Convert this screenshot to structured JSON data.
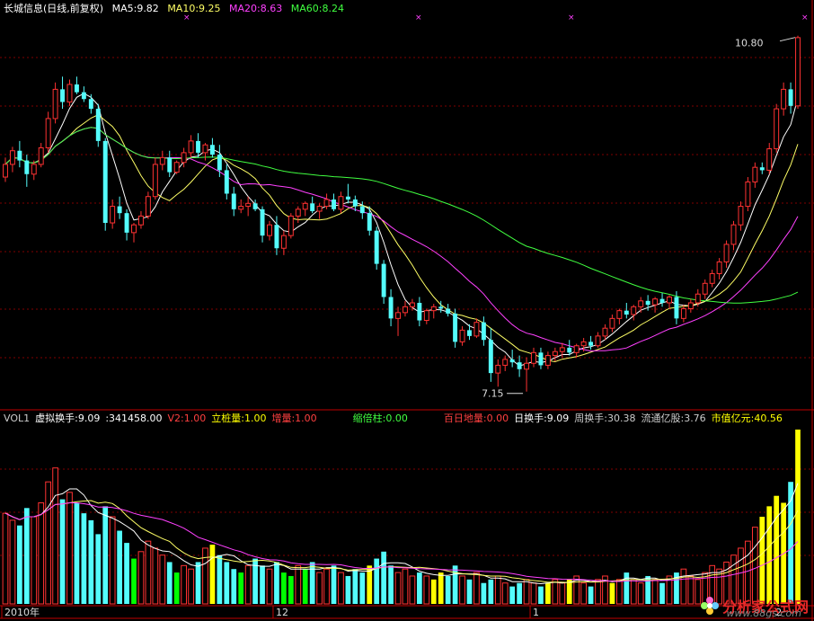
{
  "header": {
    "title": "长城信息(日线,前复权)",
    "ma": [
      {
        "label": "MA5:9.82",
        "color": "#ffffff"
      },
      {
        "label": "MA10:9.25",
        "color": "#ffff66"
      },
      {
        "label": "MA20:8.63",
        "color": "#ff40ff"
      },
      {
        "label": "MA60:8.24",
        "color": "#40ff40"
      }
    ]
  },
  "volume_header": {
    "items": [
      {
        "label": "VOL1",
        "color": "#cccccc"
      },
      {
        "label": "虚拟换手:9.09",
        "color": "#ffffff"
      },
      {
        "label": ":341458.00",
        "color": "#ffffff"
      },
      {
        "label": "V2:1.00",
        "color": "#ff4040"
      },
      {
        "label": "立桩量:1.00",
        "color": "#ffff00"
      },
      {
        "label": "增量:1.00",
        "color": "#ff4040"
      },
      {
        "label": "缩倍柱:0.00",
        "color": "#40ff40"
      },
      {
        "label": "百日地量:0.00",
        "color": "#ff4040"
      },
      {
        "label": "日换手:9.09",
        "color": "#ffffff"
      },
      {
        "label": "周换手:30.38",
        "color": "#cccccc"
      },
      {
        "label": "流通亿股:3.76",
        "color": "#cccccc"
      },
      {
        "label": "市值亿元:40.56",
        "color": "#ffff00"
      }
    ]
  },
  "annotations": {
    "high_label": "10.80",
    "low_label": "7.15"
  },
  "watermark": {
    "text": "分析家公式网",
    "url": "www.88gs.com"
  },
  "colors": {
    "up": "#ff3232",
    "down": "#54fcfc",
    "volume_highlight": "#ffff00",
    "volume_shrink": "#00ff00",
    "grid": "#800000",
    "axis": "#c00000"
  },
  "chart_data": [
    {
      "type": "candlestick",
      "title": "长城信息(日线,前复权)",
      "ylim": [
        7.0,
        11.0
      ],
      "series_names": [
        "MA5",
        "MA10",
        "MA20",
        "MA60"
      ],
      "x_ticks": [
        {
          "index": 0,
          "label": "2010年"
        },
        {
          "index": 38,
          "label": "12"
        },
        {
          "index": 74,
          "label": "1"
        },
        {
          "index": 108,
          "label": "2"
        }
      ],
      "candles": [
        [
          9.35,
          9.55,
          9.3,
          9.48
        ],
        [
          9.48,
          9.66,
          9.4,
          9.62
        ],
        [
          9.62,
          9.72,
          9.45,
          9.52
        ],
        [
          9.52,
          9.58,
          9.25,
          9.38
        ],
        [
          9.38,
          9.52,
          9.32,
          9.48
        ],
        [
          9.48,
          9.7,
          9.45,
          9.65
        ],
        [
          9.65,
          10.02,
          9.6,
          9.95
        ],
        [
          9.95,
          10.32,
          9.9,
          10.25
        ],
        [
          10.25,
          10.38,
          10.05,
          10.12
        ],
        [
          10.12,
          10.35,
          10.08,
          10.3
        ],
        [
          10.3,
          10.38,
          10.2,
          10.22
        ],
        [
          10.22,
          10.28,
          10.12,
          10.15
        ],
        [
          10.15,
          10.2,
          10.0,
          10.05
        ],
        [
          10.05,
          10.1,
          9.66,
          9.72
        ],
        [
          9.72,
          9.75,
          8.8,
          8.88
        ],
        [
          8.88,
          9.12,
          8.82,
          9.05
        ],
        [
          9.05,
          9.15,
          8.92,
          8.98
        ],
        [
          8.98,
          9.02,
          8.7,
          8.78
        ],
        [
          8.78,
          8.88,
          8.68,
          8.86
        ],
        [
          8.86,
          9.0,
          8.82,
          8.95
        ],
        [
          8.95,
          9.2,
          8.92,
          9.15
        ],
        [
          9.15,
          9.55,
          9.12,
          9.48
        ],
        [
          9.48,
          9.62,
          9.42,
          9.55
        ],
        [
          9.55,
          9.62,
          9.35,
          9.4
        ],
        [
          9.4,
          9.52,
          9.38,
          9.5
        ],
        [
          9.5,
          9.65,
          9.45,
          9.6
        ],
        [
          9.6,
          9.78,
          9.55,
          9.72
        ],
        [
          9.72,
          9.8,
          9.55,
          9.6
        ],
        [
          9.6,
          9.7,
          9.52,
          9.68
        ],
        [
          9.68,
          9.75,
          9.55,
          9.58
        ],
        [
          9.58,
          9.68,
          9.35,
          9.42
        ],
        [
          9.42,
          9.48,
          9.12,
          9.18
        ],
        [
          9.18,
          9.25,
          8.95,
          9.02
        ],
        [
          9.02,
          9.12,
          8.98,
          9.05
        ],
        [
          9.05,
          9.15,
          8.95,
          9.08
        ],
        [
          9.08,
          9.12,
          9.0,
          9.02
        ],
        [
          9.02,
          9.05,
          8.68,
          8.75
        ],
        [
          8.75,
          8.9,
          8.7,
          8.86
        ],
        [
          8.86,
          8.95,
          8.55,
          8.62
        ],
        [
          8.62,
          8.8,
          8.55,
          8.75
        ],
        [
          8.75,
          8.98,
          8.72,
          8.95
        ],
        [
          8.95,
          9.05,
          8.88,
          9.02
        ],
        [
          9.02,
          9.1,
          8.95,
          9.08
        ],
        [
          9.08,
          9.15,
          8.98,
          9.0
        ],
        [
          9.0,
          9.08,
          8.92,
          9.05
        ],
        [
          9.05,
          9.18,
          9.02,
          9.12
        ],
        [
          9.12,
          9.18,
          9.0,
          9.02
        ],
        [
          9.02,
          9.2,
          8.98,
          9.15
        ],
        [
          9.15,
          9.28,
          9.08,
          9.12
        ],
        [
          9.12,
          9.16,
          9.0,
          9.05
        ],
        [
          9.05,
          9.1,
          8.92,
          8.98
        ],
        [
          8.98,
          9.05,
          8.75,
          8.8
        ],
        [
          8.8,
          8.84,
          8.4,
          8.46
        ],
        [
          8.46,
          8.5,
          8.05,
          8.12
        ],
        [
          8.12,
          8.2,
          7.82,
          7.9
        ],
        [
          7.9,
          8.02,
          7.72,
          7.96
        ],
        [
          7.96,
          8.08,
          7.92,
          8.02
        ],
        [
          8.02,
          8.1,
          7.98,
          8.06
        ],
        [
          8.06,
          8.12,
          7.82,
          7.88
        ],
        [
          7.88,
          8.0,
          7.84,
          7.98
        ],
        [
          7.98,
          8.05,
          7.9,
          8.02
        ],
        [
          8.02,
          8.08,
          7.96,
          8.0
        ],
        [
          8.0,
          8.05,
          7.92,
          7.95
        ],
        [
          7.95,
          8.0,
          7.6,
          7.66
        ],
        [
          7.66,
          7.82,
          7.62,
          7.78
        ],
        [
          7.78,
          7.84,
          7.68,
          7.72
        ],
        [
          7.72,
          7.9,
          7.7,
          7.86
        ],
        [
          7.86,
          7.92,
          7.62,
          7.68
        ],
        [
          7.68,
          7.8,
          7.25,
          7.34
        ],
        [
          7.34,
          7.48,
          7.2,
          7.42
        ],
        [
          7.42,
          7.52,
          7.36,
          7.48
        ],
        [
          7.48,
          7.58,
          7.4,
          7.45
        ],
        [
          7.45,
          7.52,
          7.3,
          7.38
        ],
        [
          7.38,
          7.5,
          7.15,
          7.44
        ],
        [
          7.44,
          7.6,
          7.4,
          7.55
        ],
        [
          7.55,
          7.6,
          7.38,
          7.42
        ],
        [
          7.42,
          7.56,
          7.38,
          7.52
        ],
        [
          7.52,
          7.6,
          7.46,
          7.56
        ],
        [
          7.56,
          7.65,
          7.5,
          7.6
        ],
        [
          7.6,
          7.68,
          7.52,
          7.55
        ],
        [
          7.55,
          7.64,
          7.5,
          7.62
        ],
        [
          7.62,
          7.7,
          7.56,
          7.66
        ],
        [
          7.66,
          7.72,
          7.58,
          7.62
        ],
        [
          7.62,
          7.76,
          7.6,
          7.72
        ],
        [
          7.72,
          7.84,
          7.68,
          7.8
        ],
        [
          7.8,
          7.94,
          7.76,
          7.9
        ],
        [
          7.9,
          8.0,
          7.84,
          7.98
        ],
        [
          7.98,
          8.06,
          7.9,
          7.94
        ],
        [
          7.94,
          8.04,
          7.88,
          8.02
        ],
        [
          8.02,
          8.12,
          7.96,
          8.08
        ],
        [
          8.08,
          8.14,
          7.98,
          8.04
        ],
        [
          8.04,
          8.12,
          7.96,
          8.1
        ],
        [
          8.1,
          8.16,
          8.02,
          8.06
        ],
        [
          8.06,
          8.14,
          8.0,
          8.12
        ],
        [
          8.12,
          8.18,
          7.84,
          7.9
        ],
        [
          7.9,
          8.04,
          7.86,
          8.0
        ],
        [
          8.0,
          8.1,
          7.96,
          8.06
        ],
        [
          8.06,
          8.2,
          8.02,
          8.15
        ],
        [
          8.15,
          8.3,
          8.1,
          8.26
        ],
        [
          8.26,
          8.4,
          8.22,
          8.36
        ],
        [
          8.36,
          8.52,
          8.3,
          8.48
        ],
        [
          8.48,
          8.7,
          8.42,
          8.66
        ],
        [
          8.66,
          8.9,
          8.6,
          8.86
        ],
        [
          8.86,
          9.1,
          8.8,
          9.05
        ],
        [
          9.05,
          9.35,
          9.0,
          9.3
        ],
        [
          9.3,
          9.5,
          9.24,
          9.45
        ],
        [
          9.45,
          9.5,
          9.38,
          9.42
        ],
        [
          9.42,
          9.7,
          9.38,
          9.64
        ],
        [
          9.64,
          10.1,
          9.6,
          10.05
        ],
        [
          10.05,
          10.32,
          9.98,
          10.25
        ],
        [
          10.25,
          10.32,
          10.0,
          10.08
        ],
        [
          10.08,
          10.8,
          10.05,
          10.78
        ]
      ]
    },
    {
      "type": "bar",
      "title": "VOL1",
      "ylim": [
        0,
        100
      ],
      "bar_kinds": "n=normal, h=highlight(立桩量), s=shrink(缩倍柱)",
      "bars": [
        [
          52,
          "n"
        ],
        [
          48,
          "n"
        ],
        [
          45,
          "n"
        ],
        [
          55,
          "n"
        ],
        [
          50,
          "n"
        ],
        [
          58,
          "n"
        ],
        [
          70,
          "n"
        ],
        [
          78,
          "n"
        ],
        [
          60,
          "n"
        ],
        [
          64,
          "n"
        ],
        [
          58,
          "n"
        ],
        [
          52,
          "n"
        ],
        [
          48,
          "n"
        ],
        [
          40,
          "n"
        ],
        [
          56,
          "n"
        ],
        [
          50,
          "n"
        ],
        [
          42,
          "n"
        ],
        [
          35,
          "n"
        ],
        [
          26,
          "s"
        ],
        [
          30,
          "n"
        ],
        [
          36,
          "n"
        ],
        [
          32,
          "n"
        ],
        [
          28,
          "n"
        ],
        [
          24,
          "n"
        ],
        [
          18,
          "s"
        ],
        [
          22,
          "n"
        ],
        [
          20,
          "n"
        ],
        [
          24,
          "n"
        ],
        [
          32,
          "n"
        ],
        [
          34,
          "h"
        ],
        [
          28,
          "n"
        ],
        [
          24,
          "n"
        ],
        [
          20,
          "n"
        ],
        [
          18,
          "s"
        ],
        [
          22,
          "n"
        ],
        [
          26,
          "n"
        ],
        [
          22,
          "n"
        ],
        [
          20,
          "n"
        ],
        [
          24,
          "n"
        ],
        [
          18,
          "s"
        ],
        [
          16,
          "s"
        ],
        [
          22,
          "n"
        ],
        [
          20,
          "s"
        ],
        [
          24,
          "n"
        ],
        [
          18,
          "n"
        ],
        [
          20,
          "n"
        ],
        [
          22,
          "n"
        ],
        [
          18,
          "n"
        ],
        [
          16,
          "n"
        ],
        [
          20,
          "n"
        ],
        [
          18,
          "n"
        ],
        [
          22,
          "h"
        ],
        [
          26,
          "n"
        ],
        [
          30,
          "n"
        ],
        [
          22,
          "n"
        ],
        [
          18,
          "n"
        ],
        [
          20,
          "n"
        ],
        [
          16,
          "n"
        ],
        [
          18,
          "n"
        ],
        [
          16,
          "n"
        ],
        [
          14,
          "h"
        ],
        [
          18,
          "h"
        ],
        [
          16,
          "n"
        ],
        [
          22,
          "n"
        ],
        [
          16,
          "n"
        ],
        [
          14,
          "n"
        ],
        [
          18,
          "n"
        ],
        [
          12,
          "n"
        ],
        [
          14,
          "n"
        ],
        [
          16,
          "n"
        ],
        [
          12,
          "n"
        ],
        [
          10,
          "n"
        ],
        [
          12,
          "n"
        ],
        [
          14,
          "n"
        ],
        [
          12,
          "n"
        ],
        [
          10,
          "n"
        ],
        [
          12,
          "h"
        ],
        [
          14,
          "n"
        ],
        [
          12,
          "n"
        ],
        [
          14,
          "h"
        ],
        [
          16,
          "n"
        ],
        [
          12,
          "n"
        ],
        [
          10,
          "n"
        ],
        [
          14,
          "n"
        ],
        [
          16,
          "n"
        ],
        [
          12,
          "h"
        ],
        [
          14,
          "n"
        ],
        [
          18,
          "n"
        ],
        [
          14,
          "n"
        ],
        [
          12,
          "n"
        ],
        [
          16,
          "n"
        ],
        [
          14,
          "n"
        ],
        [
          12,
          "n"
        ],
        [
          16,
          "n"
        ],
        [
          18,
          "n"
        ],
        [
          20,
          "n"
        ],
        [
          16,
          "n"
        ],
        [
          14,
          "n"
        ],
        [
          18,
          "n"
        ],
        [
          22,
          "n"
        ],
        [
          20,
          "n"
        ],
        [
          24,
          "n"
        ],
        [
          28,
          "n"
        ],
        [
          32,
          "n"
        ],
        [
          36,
          "n"
        ],
        [
          44,
          "n"
        ],
        [
          50,
          "h"
        ],
        [
          56,
          "h"
        ],
        [
          62,
          "h"
        ],
        [
          58,
          "h"
        ],
        [
          70,
          "n"
        ],
        [
          100,
          "h"
        ]
      ]
    }
  ]
}
